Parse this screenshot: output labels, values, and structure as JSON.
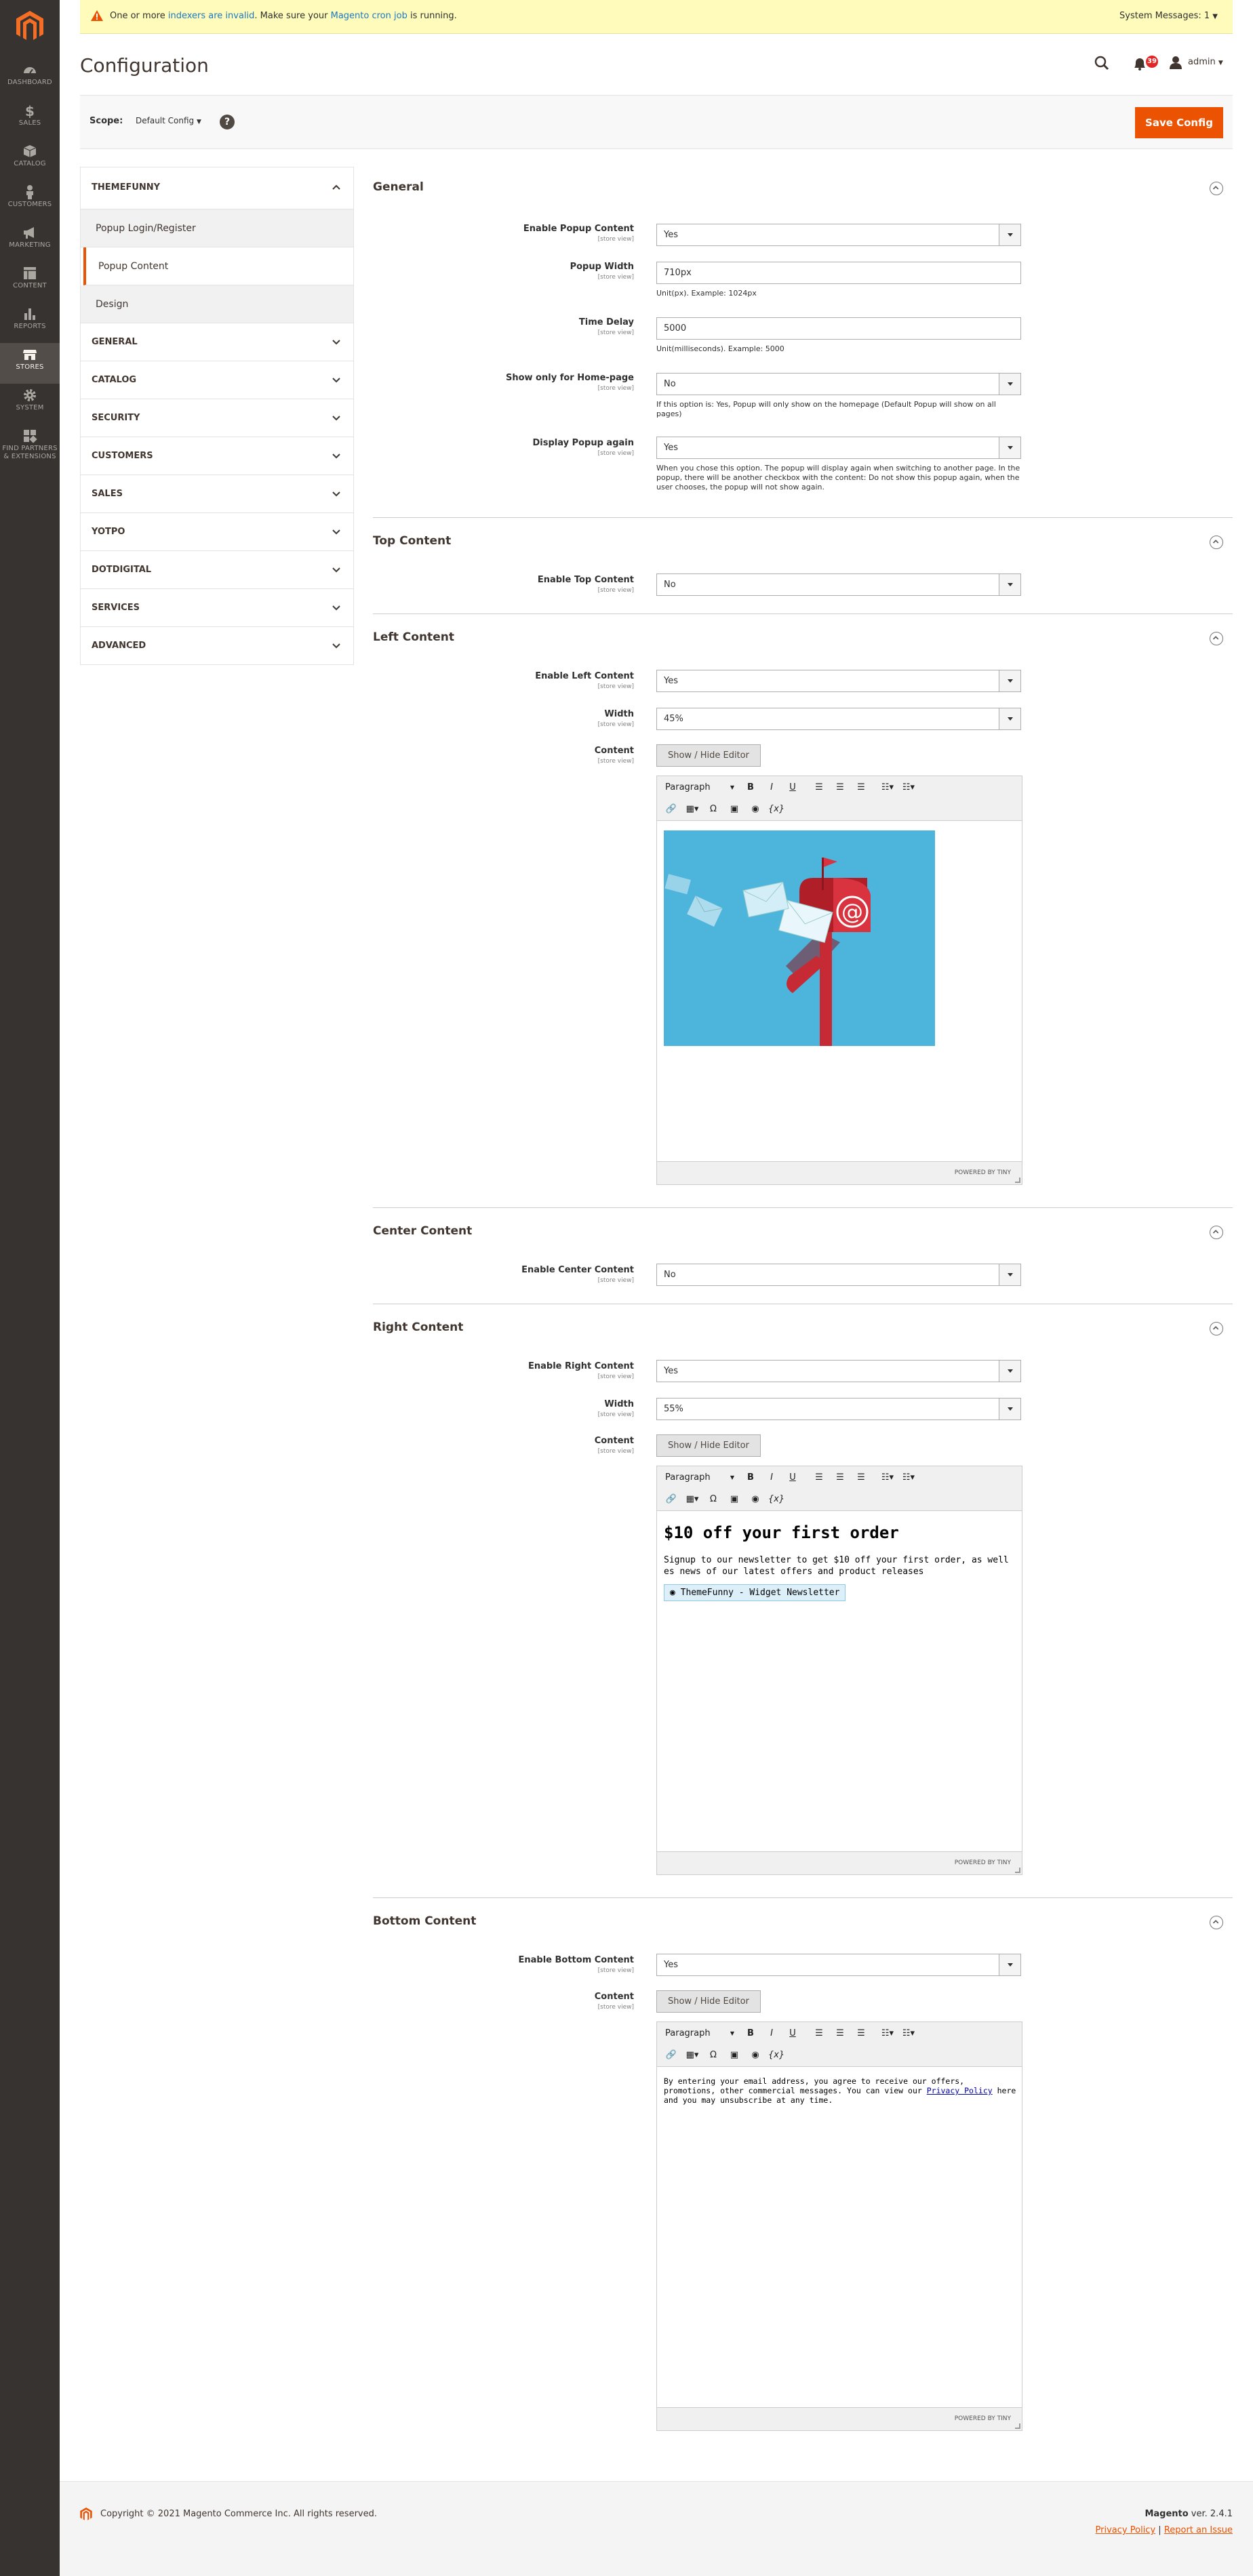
{
  "nav": [
    {
      "label": "Dashboard",
      "icon": "dashboard-icon"
    },
    {
      "label": "Sales",
      "icon": "dollar-icon"
    },
    {
      "label": "Catalog",
      "icon": "box-icon"
    },
    {
      "label": "Customers",
      "icon": "person-icon"
    },
    {
      "label": "Marketing",
      "icon": "megaphone-icon"
    },
    {
      "label": "Content",
      "icon": "layout-icon"
    },
    {
      "label": "Reports",
      "icon": "bar-chart-icon"
    },
    {
      "label": "Stores",
      "icon": "store-icon"
    },
    {
      "label": "System",
      "icon": "gear-icon"
    },
    {
      "label": "Find Partners & Extensions",
      "icon": "blocks-icon"
    }
  ],
  "message_bar": {
    "prefix": "One or more ",
    "link1": "indexers are invalid",
    "middle": ". Make sure your ",
    "link2": "Magento cron job",
    "suffix": " is running.",
    "system_messages": "System Messages: 1"
  },
  "header": {
    "title": "Configuration",
    "notification_count": "39",
    "user": "admin"
  },
  "actions": {
    "scope_label": "Scope:",
    "scope_value": "Default Config",
    "save_label": "Save Config"
  },
  "left_tabs": {
    "themefunny": "THEMEFUNNY",
    "sub_items": [
      "Popup Login/Register",
      "Popup Content",
      "Design"
    ],
    "others": [
      "GENERAL",
      "CATALOG",
      "SECURITY",
      "CUSTOMERS",
      "SALES",
      "YOTPO",
      "DOTDIGITAL",
      "SERVICES",
      "ADVANCED"
    ]
  },
  "scope_note": "[store view]",
  "general": {
    "title": "General",
    "enable_label": "Enable Popup Content",
    "enable_value": "Yes",
    "width_label": "Popup Width",
    "width_value": "710px",
    "width_hint": "Unit(px). Example: 1024px",
    "delay_label": "Time Delay",
    "delay_value": "5000",
    "delay_hint": "Unit(milliseconds). Example: 5000",
    "home_label": "Show only for Home-page",
    "home_value": "No",
    "home_hint": "If this option is: Yes, Popup will only show on the homepage (Default Popup will show on all pages)",
    "again_label": "Display Popup again",
    "again_value": "Yes",
    "again_hint": "When you chose this option. The popup will display again when switching to another page. In the popup, there will be another checkbox with the content: Do not show this popup again, when the user chooses, the popup will not show again."
  },
  "top": {
    "title": "Top Content",
    "enable_label": "Enable Top Content",
    "enable_value": "No"
  },
  "leftc": {
    "title": "Left Content",
    "enable_label": "Enable Left Content",
    "enable_value": "Yes",
    "width_label": "Width",
    "width_value": "45%",
    "content_label": "Content"
  },
  "center": {
    "title": "Center Content",
    "enable_label": "Enable Center Content",
    "enable_value": "No"
  },
  "right": {
    "title": "Right Content",
    "enable_label": "Enable Right Content",
    "enable_value": "Yes",
    "width_label": "Width",
    "width_value": "55%",
    "content_label": "Content",
    "heading": "$10 off your first order",
    "body": "Signup to our newsletter to get $10 off your first order, as well es news of our latest offers and product releases",
    "widget": "ThemeFunny - Widget Newsletter"
  },
  "bottom": {
    "title": "Bottom Content",
    "enable_label": "Enable Bottom Content",
    "enable_value": "Yes",
    "content_label": "Content",
    "text_before": "By entering your email address, you agree to receive our offers, promotions, other commercial messages. You can view our ",
    "link": "Privacy Policy",
    "text_after": " here and you may unsubscribe at any time."
  },
  "editor": {
    "show_hide": "Show / Hide Editor",
    "paragraph": "Paragraph",
    "bold": "B",
    "italic": "I",
    "underline": "U",
    "omega": "Ω",
    "var": "{x}",
    "powered": "POWERED BY TINY"
  },
  "footer": {
    "copyright": "Copyright © 2021 Magento Commerce Inc. All rights reserved.",
    "brand": "Magento",
    "version": " ver. 2.4.1",
    "privacy": "Privacy Policy",
    "sep": " | ",
    "report": "Report an Issue"
  },
  "colors": {
    "accent": "#eb5202",
    "sidebar": "#373330",
    "link": "#1979c3",
    "message_bg": "#fffbbb",
    "image_bg": "#4db4dc"
  }
}
